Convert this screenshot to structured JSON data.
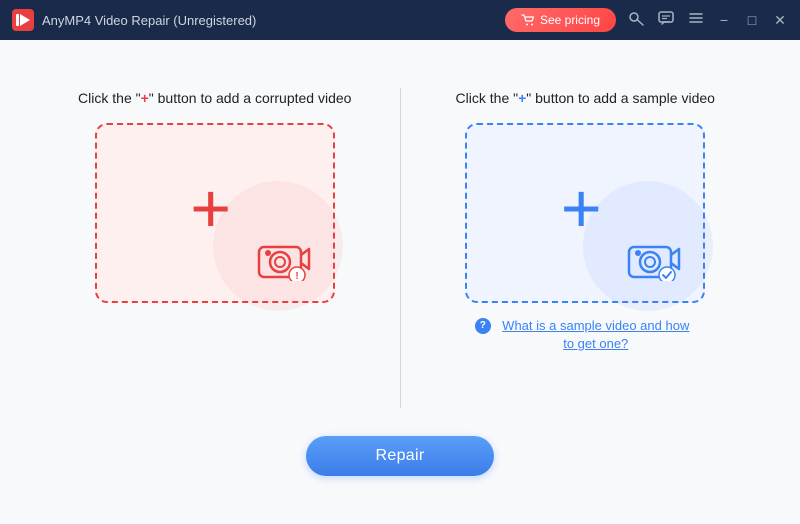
{
  "titlebar": {
    "logo_alt": "AnyMP4 Logo",
    "title": "AnyMP4 Video Repair (Unregistered)",
    "pricing_label": "See pricing",
    "icons": [
      "key",
      "chat",
      "menu"
    ],
    "controls": [
      "minimize",
      "maximize",
      "close"
    ]
  },
  "left_panel": {
    "instruction_prefix": "Click the \"",
    "instruction_plus": "+",
    "instruction_suffix": "\" button to add a corrupted video",
    "plus_symbol": "+",
    "color": "red"
  },
  "right_panel": {
    "instruction_prefix": "Click the \"",
    "instruction_plus": "+",
    "instruction_suffix": "\" button to add a sample video",
    "plus_symbol": "+",
    "color": "blue",
    "help_text": "What is a sample video and how to get one?"
  },
  "repair_button": {
    "label": "Repair"
  }
}
